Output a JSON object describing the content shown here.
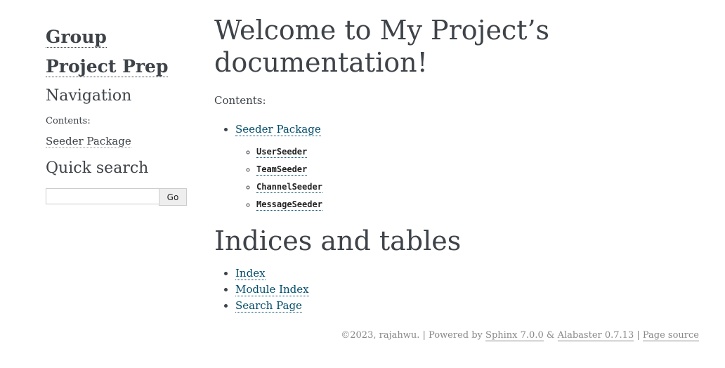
{
  "sidebar": {
    "logo_line1": "Group",
    "logo_line2": "Project Prep",
    "navigation_heading": "Navigation",
    "contents_caption": "Contents:",
    "nav_link": "Seeder Package",
    "search_heading": "Quick search",
    "search_value": "",
    "go_label": "Go"
  },
  "main": {
    "title_line1": "Welcome to My Project’s",
    "title_line2": "documentation!",
    "contents_caption": "Contents:",
    "toc": {
      "label": "Seeder Package",
      "children": [
        "UserSeeder",
        "TeamSeeder",
        "ChannelSeeder",
        "MessageSeeder"
      ]
    },
    "indices_heading": "Indices and tables",
    "indices": [
      "Index",
      "Module Index",
      "Search Page"
    ]
  },
  "footer": {
    "copyright": "©2023, rajahwu. | Powered by ",
    "sphinx": "Sphinx 7.0.0",
    "amp": " & ",
    "alabaster": "Alabaster 0.7.13",
    "sep": " | ",
    "page_source": "Page source"
  }
}
